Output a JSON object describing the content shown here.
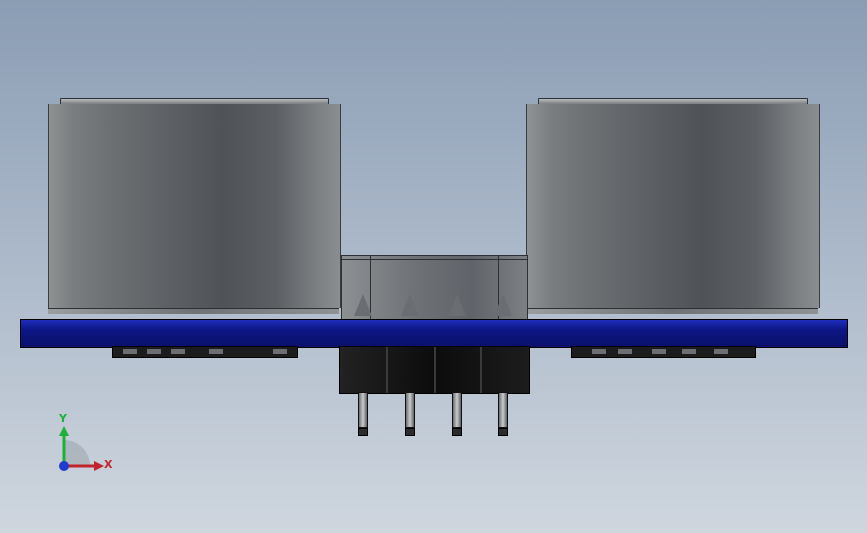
{
  "view": {
    "background": "#9fb0c4",
    "model": {
      "left_transducer": "cylinder-transducer",
      "right_transducer": "cylinder-transducer",
      "pcb_color": "#0d1785",
      "connector_pins": 4
    }
  },
  "triad": {
    "y_label": "Y",
    "x_label": "X",
    "y_color": "#1fae3a",
    "x_color": "#c0242c",
    "z_color": "#1f3dc8"
  }
}
